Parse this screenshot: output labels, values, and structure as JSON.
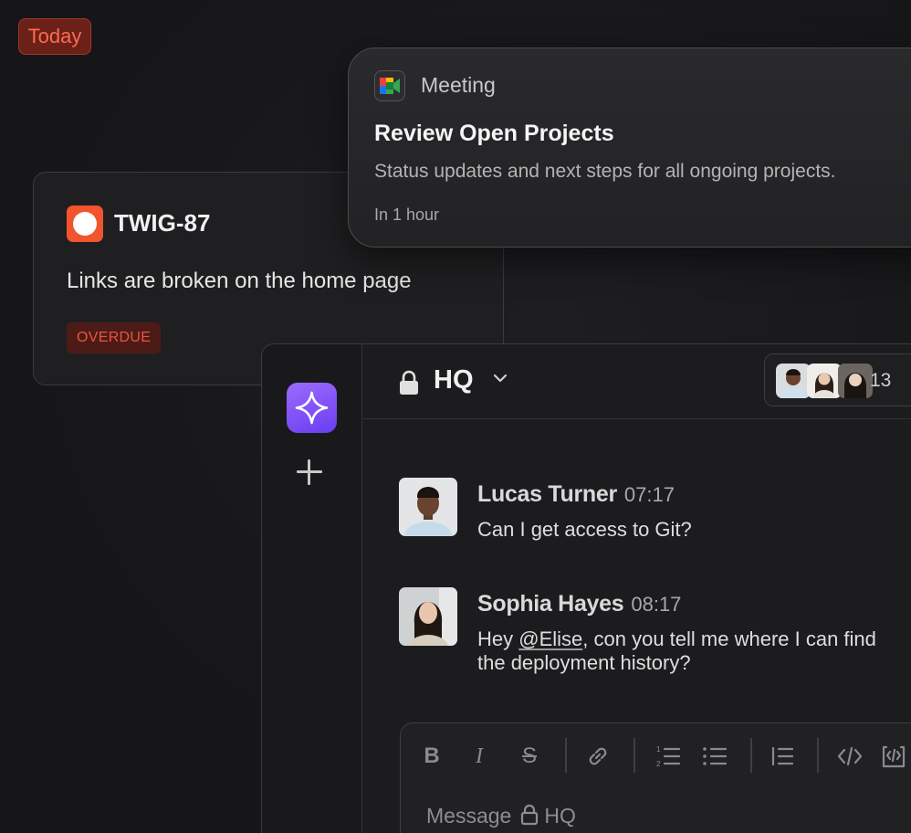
{
  "today_chip": {
    "label": "Today"
  },
  "issue": {
    "id": "TWIG-87",
    "title": "Links are broken on the home page",
    "status": "OVERDUE",
    "icon": "issue-status-icon",
    "accent": "#f2542d"
  },
  "meeting": {
    "label": "Meeting",
    "title": "Review Open Projects",
    "description": "Status updates and next steps for all ongoing projects.",
    "time": "In 1 hour",
    "icon": "google-meet-icon"
  },
  "chat": {
    "channel": "HQ",
    "channel_icon": "lock-icon",
    "member_count": "13",
    "messages": [
      {
        "author": "Lucas Turner",
        "time": "07:17",
        "text": "Can I get access to Git?"
      },
      {
        "author": "Sophia Hayes",
        "time": "08:17",
        "text_before": "Hey ",
        "mention": "@Elise",
        "text_after": ", con you tell me where I can find the deployment history?"
      }
    ],
    "composer": {
      "placeholder_prefix": "Message",
      "placeholder_channel": "HQ",
      "toolbar": [
        "bold-icon",
        "italic-icon",
        "strikethrough-icon",
        "link-icon",
        "ordered-list-icon",
        "bullet-list-icon",
        "blockquote-icon",
        "code-icon",
        "code-block-icon"
      ]
    }
  },
  "colors": {
    "background": "#19191b",
    "today_chip": "#6b2018",
    "overdue_text": "#e8553f",
    "ai_button": "#7b4cf6"
  }
}
